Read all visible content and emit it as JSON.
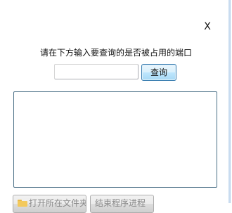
{
  "dialog": {
    "close_label": "X",
    "prompt": "请在下方输入要查询的是否被占用的端口",
    "port_input": {
      "value": "",
      "placeholder": ""
    },
    "query_button_label": "查询",
    "result_text": "",
    "open_folder_button_label": "打开所在文件夹",
    "kill_process_button_label": "结束程序进程"
  },
  "icons": {
    "open_folder_button": "folder-icon"
  },
  "colors": {
    "query_button_border": "#3c7fb1",
    "result_box_border": "#4a6f86"
  }
}
